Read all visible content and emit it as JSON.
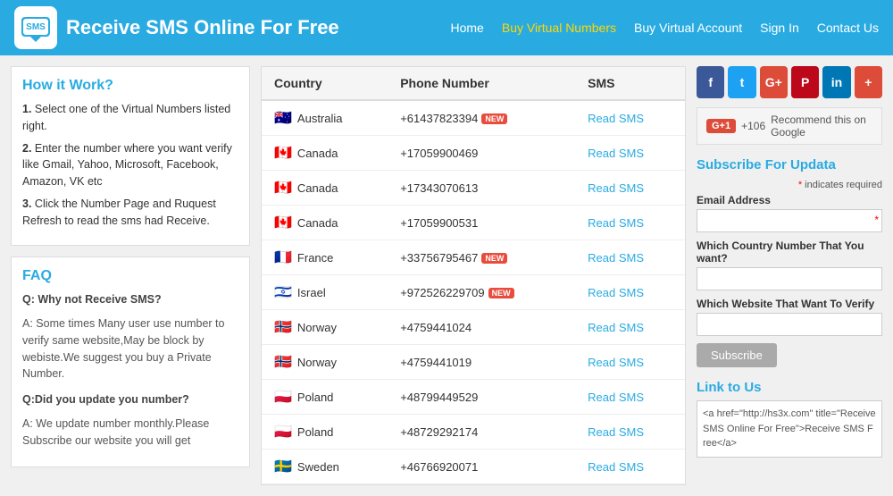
{
  "header": {
    "title": "Receive SMS Online For Free",
    "nav": [
      {
        "label": "Home",
        "highlight": false
      },
      {
        "label": "Buy Virtual Numbers",
        "highlight": true
      },
      {
        "label": "Buy Virtual Account",
        "highlight": false
      },
      {
        "label": "Sign In",
        "highlight": false
      },
      {
        "label": "Contact Us",
        "highlight": false
      }
    ]
  },
  "left": {
    "howItWork": {
      "title": "How it Work?",
      "steps": [
        {
          "num": "1.",
          "text": "Select one of the Virtual Numbers listed right."
        },
        {
          "num": "2.",
          "text": "Enter the number where you want verify like Gmail, Yahoo, Microsoft, Facebook, Amazon, VK etc"
        },
        {
          "num": "3.",
          "text": "Click the Number Page and Ruquest Refresh to read the sms had Receive."
        }
      ]
    },
    "faq": {
      "title": "FAQ",
      "items": [
        {
          "q": "Q: Why not Receive SMS?",
          "a": "A: Some times Many user use number to verify same website,May be block by webiste.We suggest you buy a Private Number."
        },
        {
          "q": "Q:Did you update you number?",
          "a": "A: We update number monthly.Please Subscribe our website you will get"
        }
      ]
    }
  },
  "table": {
    "headers": [
      "Country",
      "Phone Number",
      "SMS"
    ],
    "rows": [
      {
        "flag": "🇦🇺",
        "country": "Australia",
        "phone": "+61437823394",
        "isNew": true,
        "smsLabel": "Read SMS"
      },
      {
        "flag": "🇨🇦",
        "country": "Canada",
        "phone": "+17059900469",
        "isNew": false,
        "smsLabel": "Read SMS"
      },
      {
        "flag": "🇨🇦",
        "country": "Canada",
        "phone": "+17343070613",
        "isNew": false,
        "smsLabel": "Read SMS"
      },
      {
        "flag": "🇨🇦",
        "country": "Canada",
        "phone": "+17059900531",
        "isNew": false,
        "smsLabel": "Read SMS"
      },
      {
        "flag": "🇫🇷",
        "country": "France",
        "phone": "+33756795467",
        "isNew": true,
        "smsLabel": "Read SMS"
      },
      {
        "flag": "🇮🇱",
        "country": "Israel",
        "phone": "+972526229709",
        "isNew": true,
        "smsLabel": "Read SMS"
      },
      {
        "flag": "🇳🇴",
        "country": "Norway",
        "phone": "+4759441024",
        "isNew": false,
        "smsLabel": "Read SMS"
      },
      {
        "flag": "🇳🇴",
        "country": "Norway",
        "phone": "+4759441019",
        "isNew": false,
        "smsLabel": "Read SMS"
      },
      {
        "flag": "🇵🇱",
        "country": "Poland",
        "phone": "+48799449529",
        "isNew": false,
        "smsLabel": "Read SMS"
      },
      {
        "flag": "🇵🇱",
        "country": "Poland",
        "phone": "+48729292174",
        "isNew": false,
        "smsLabel": "Read SMS"
      },
      {
        "flag": "🇸🇪",
        "country": "Sweden",
        "phone": "+46766920071",
        "isNew": false,
        "smsLabel": "Read SMS"
      }
    ]
  },
  "right": {
    "social": {
      "buttons": [
        {
          "label": "f",
          "class": "fb",
          "title": "Facebook"
        },
        {
          "label": "t",
          "class": "tw",
          "title": "Twitter"
        },
        {
          "label": "G+",
          "class": "gp",
          "title": "Google Plus"
        },
        {
          "label": "P",
          "class": "pi",
          "title": "Pinterest"
        },
        {
          "label": "in",
          "class": "li",
          "title": "LinkedIn"
        },
        {
          "label": "+",
          "class": "pl",
          "title": "More"
        }
      ],
      "googleBar": {
        "btnLabel": "G+1",
        "count": "+106",
        "text": "Recommend this on Google"
      }
    },
    "subscribe": {
      "title": "Subscribe For Updata",
      "reqNote": "* indicates required",
      "emailLabel": "Email Address",
      "emailPlaceholder": "",
      "countryLabel": "Which Country Number That You want?",
      "websiteLabel": "Which Website That Want To Verify",
      "btnLabel": "Subscribe"
    },
    "linkToUs": {
      "title": "Link to Us",
      "code": "<a href=\"http://hs3x.com\" title=\"Receive SMS Online For Free\">Receive SMS Free</a>"
    }
  }
}
